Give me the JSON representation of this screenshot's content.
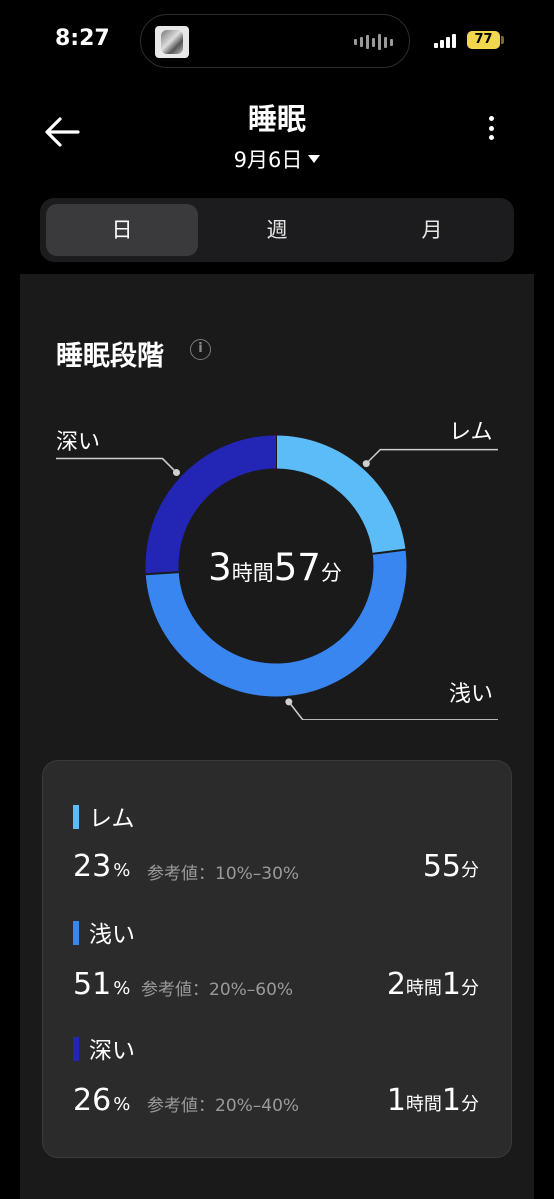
{
  "status_bar": {
    "time": "8:27",
    "battery": "77"
  },
  "header": {
    "title": "睡眠",
    "date": "9月6日"
  },
  "tabs": [
    {
      "label": "日",
      "active": true
    },
    {
      "label": "週",
      "active": false
    },
    {
      "label": "月",
      "active": false
    }
  ],
  "section": {
    "title": "睡眠段階",
    "info_icon_glyph": "i"
  },
  "chart_data": {
    "type": "pie",
    "style": "donut",
    "center_label": {
      "hours": "3",
      "hours_unit": "時間",
      "minutes": "57",
      "minutes_unit": "分"
    },
    "slices": [
      {
        "name": "レム",
        "value": 23,
        "color": "#5bbcf7"
      },
      {
        "name": "浅い",
        "value": 51,
        "color": "#3a86f0"
      },
      {
        "name": "深い",
        "value": 26,
        "color": "#2326b5"
      }
    ]
  },
  "legend": [
    {
      "name": "レム",
      "color": "#5bbcf7",
      "percent": "23",
      "percent_unit": "%",
      "reference": "参考値：10%–30%",
      "duration": [
        {
          "num": "55",
          "unit": "分"
        }
      ]
    },
    {
      "name": "浅い",
      "color": "#3a86f0",
      "percent": "51",
      "percent_unit": "%",
      "reference": "参考値：20%–60%",
      "duration": [
        {
          "num": "2",
          "unit": "時間"
        },
        {
          "num": "1",
          "unit": "分"
        }
      ]
    },
    {
      "name": "深い",
      "color": "#2326b5",
      "percent": "26",
      "percent_unit": "%",
      "reference": "参考値：20%–40%",
      "duration": [
        {
          "num": "1",
          "unit": "時間"
        },
        {
          "num": "1",
          "unit": "分"
        }
      ]
    }
  ]
}
